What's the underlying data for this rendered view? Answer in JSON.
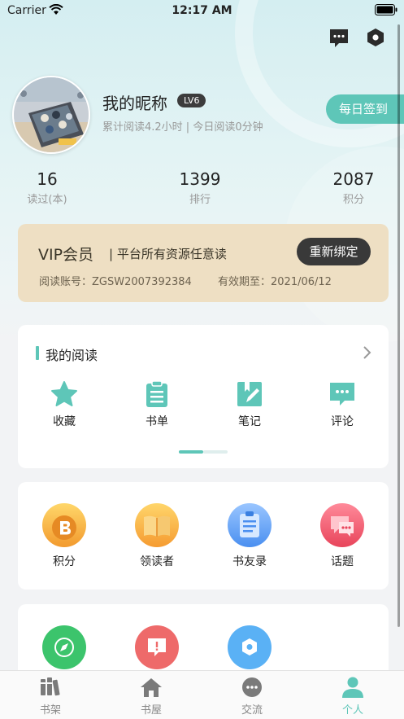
{
  "status_bar": {
    "carrier": "Carrier",
    "time": "12:17 AM"
  },
  "profile": {
    "nickname": "我的昵称",
    "level": "LV6",
    "reading_time": "累计阅读4.2小时 | 今日阅读0分钟",
    "checkin_label": "每日签到"
  },
  "stats": [
    {
      "value": "16",
      "label": "读过(本)"
    },
    {
      "value": "1399",
      "label": "排行"
    },
    {
      "value": "2087",
      "label": "积分"
    }
  ],
  "vip": {
    "title": "VIP会员",
    "description": "| 平台所有资源任意读",
    "rebind_label": "重新绑定",
    "account": "阅读账号：ZGSW2007392384",
    "expiry": "有效期至：2021/06/12"
  },
  "my_reading": {
    "title": "我的阅读",
    "items": [
      {
        "label": "收藏",
        "icon": "star-icon"
      },
      {
        "label": "书单",
        "icon": "clipboard-list-icon"
      },
      {
        "label": "笔记",
        "icon": "note-pen-icon"
      },
      {
        "label": "评论",
        "icon": "comment-bubble-icon"
      }
    ]
  },
  "features": [
    {
      "label": "积分",
      "icon": "points-coin-icon"
    },
    {
      "label": "领读者",
      "icon": "open-book-icon"
    },
    {
      "label": "书友录",
      "icon": "document-list-icon"
    },
    {
      "label": "话题",
      "icon": "chat-topic-icon"
    }
  ],
  "more_icons": [
    "compass-icon",
    "alert-message-icon",
    "hexagon-settings-icon"
  ],
  "tabs": [
    {
      "label": "书架",
      "icon": "bookshelf-icon",
      "active": false
    },
    {
      "label": "书屋",
      "icon": "house-icon",
      "active": false
    },
    {
      "label": "交流",
      "icon": "chat-dots-icon",
      "active": false
    },
    {
      "label": "个人",
      "icon": "person-icon",
      "active": true
    }
  ],
  "colors": {
    "accent": "#5ec6b8",
    "vip_bg": "#eedfc3",
    "dark": "#393939"
  }
}
